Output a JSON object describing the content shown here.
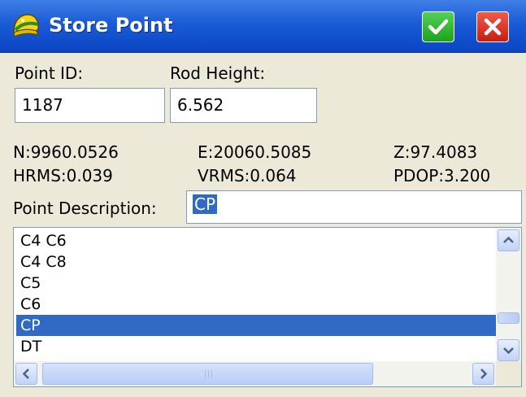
{
  "window": {
    "title": "Store Point",
    "ok_icon": "checkmark-icon",
    "close_icon": "close-icon",
    "app_icon": "helmet-icon"
  },
  "form": {
    "point_id_label": "Point ID:",
    "point_id_value": "1187",
    "rod_height_label": "Rod Height:",
    "rod_height_value": "6.562"
  },
  "coords": {
    "n": "N:9960.0526",
    "e": "E:20060.5085",
    "z": "Z:97.4083",
    "hrms": "HRMS:0.039",
    "vrms": "VRMS:0.064",
    "pdop": "PDOP:3.200"
  },
  "description": {
    "label": "Point Description:",
    "value": "CP"
  },
  "list": {
    "items": [
      "C4 C6",
      "C4 C8",
      "C5",
      "C6",
      "CP",
      "DT"
    ],
    "selected": "CP"
  },
  "colors": {
    "titlebar": "#0b45c4",
    "selection": "#316ac5",
    "ok": "#1ea21e",
    "close": "#c61e12"
  }
}
